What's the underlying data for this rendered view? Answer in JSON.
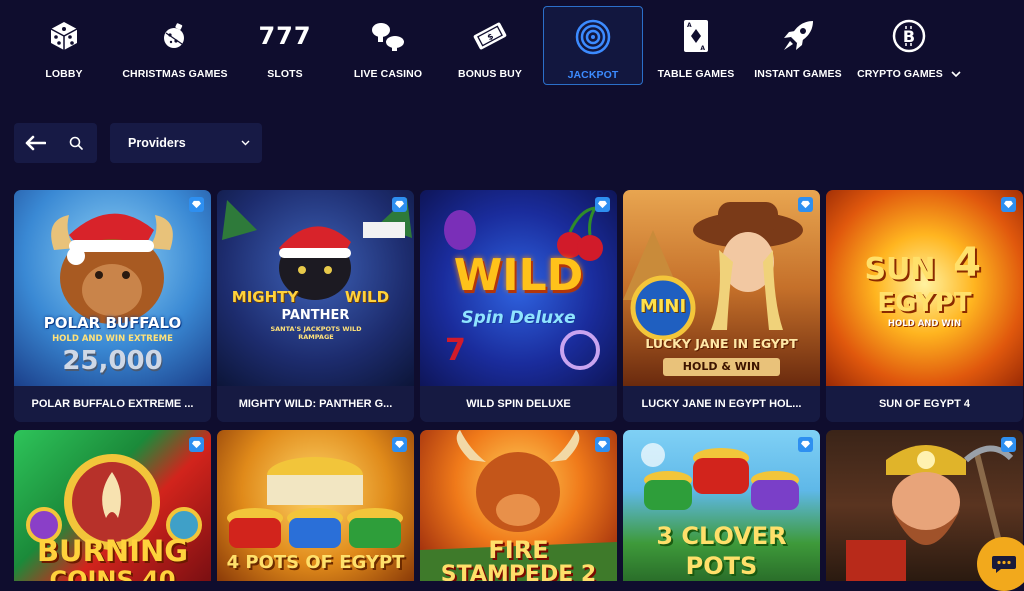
{
  "nav": [
    {
      "label": "LOBBY",
      "icon": "dice-icon"
    },
    {
      "label": "CHRISTMAS GAMES",
      "icon": "christmas-ornament-icon"
    },
    {
      "label": "SLOTS",
      "icon": "seven-seven-seven-icon",
      "glyph": "777"
    },
    {
      "label": "LIVE CASINO",
      "icon": "mushroom-chips-icon"
    },
    {
      "label": "BONUS BUY",
      "icon": "ticket-icon"
    },
    {
      "label": "JACKPOT",
      "icon": "target-icon",
      "active": true
    },
    {
      "label": "TABLE GAMES",
      "icon": "playing-card-icon"
    },
    {
      "label": "INSTANT GAMES",
      "icon": "rocket-icon"
    },
    {
      "label": "CRYPTO GAMES",
      "icon": "bitcoin-icon"
    }
  ],
  "toolbar": {
    "back_icon": "arrow-left-icon",
    "search_icon": "search-icon",
    "providers_label": "Providers"
  },
  "games": [
    {
      "title": "POLAR BUFFALO EXTREME ...",
      "art": [
        "POLAR BUFFALO",
        "HOLD AND WIN EXTREME",
        "25,000"
      ]
    },
    {
      "title": "MIGHTY WILD: PANTHER G...",
      "art": [
        "MIGHTY",
        "WILD",
        "PANTHER",
        "SANTA'S JACKPOTS WILD RAMPAGE"
      ]
    },
    {
      "title": "WILD SPIN DELUXE",
      "art": [
        "WILD",
        "Spin Deluxe"
      ]
    },
    {
      "title": "LUCKY JANE IN EGYPT HOL...",
      "art": [
        "MINI",
        "LUCKY JANE IN EGYPT",
        "HOLD & WIN"
      ]
    },
    {
      "title": "SUN OF EGYPT 4",
      "art": [
        "SUN",
        "4",
        "EGYPT",
        "HOLD AND WIN"
      ]
    },
    {
      "title": "",
      "art": [
        "BURNING",
        "COINS 40"
      ]
    },
    {
      "title": "",
      "art": [
        "4 POTS OF EGYPT"
      ]
    },
    {
      "title": "",
      "art": [
        "FIRE",
        "STAMPEDE 2"
      ]
    },
    {
      "title": "",
      "art": [
        "3 CLOVER",
        "POTS"
      ]
    },
    {
      "title": "",
      "art": []
    }
  ],
  "colors": {
    "background": "#0f0d2e",
    "accent": "#3c8bff",
    "card": "#161a42",
    "chat": "#f2a91c"
  },
  "chat_icon": "chat-bubble-icon"
}
